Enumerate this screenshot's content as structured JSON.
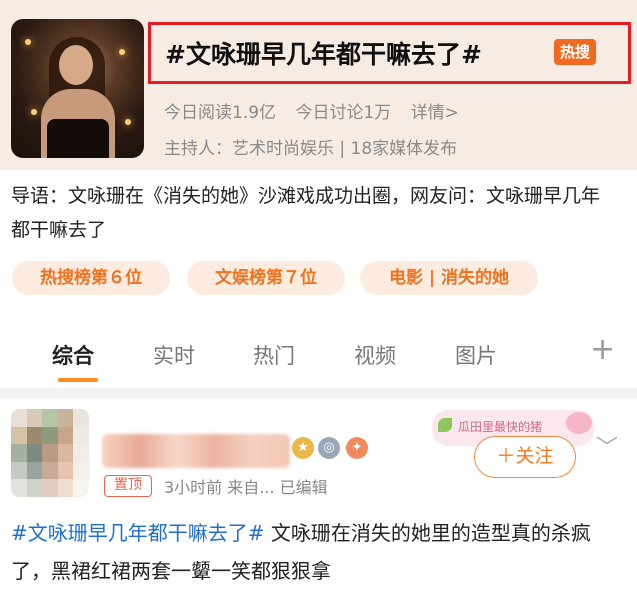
{
  "topic": {
    "title": "#文咏珊早几年都干嘛去了#",
    "badge": "热搜",
    "read": "今日阅读1.9亿",
    "discuss": "今日讨论1万",
    "details": "详情>",
    "host": "主持人：艺术时尚娱乐 | 18家媒体发布",
    "guide": "导语：文咏珊在《消失的她》沙滩戏成功出圈，网友问：文咏珊早几年都干嘛去了"
  },
  "chips": [
    "热搜榜第６位",
    "文娱榜第７位",
    "电影 | 消失的她"
  ],
  "tabs": [
    "综合",
    "实时",
    "热门",
    "视频",
    "图片"
  ],
  "post": {
    "pinned": "置顶",
    "meta": "3小时前  来自...  已编辑",
    "follow": "＋关注",
    "decor_text": "瓜田里最快的猪",
    "hashtag": "#文咏珊早几年都干嘛去了#",
    "text": " 文咏珊在消失的她里的造型真的杀疯了，黑裙红裙两套一颦一笑都狠狠拿"
  },
  "colors": {
    "accent": "#f26a1f",
    "highlight_border": "#e51c23",
    "link": "#1f6fd1"
  }
}
